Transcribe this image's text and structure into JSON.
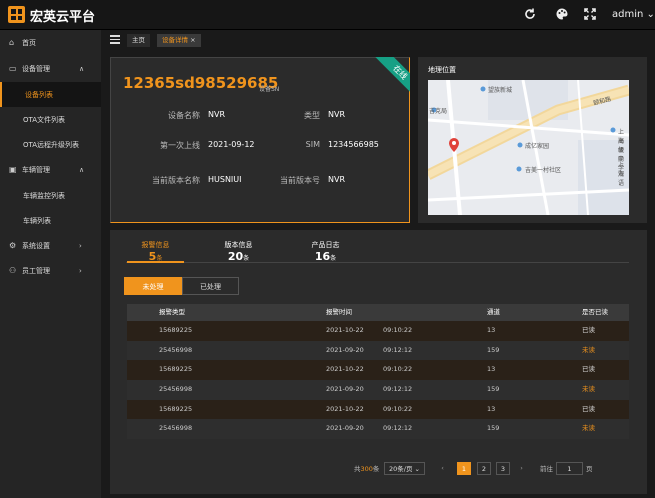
{
  "header": {
    "app_title": "宏英云平台",
    "refresh_icon": "refresh-icon",
    "theme_icon": "palette-icon",
    "fullscreen_icon": "fullscreen-icon",
    "user": "admin"
  },
  "sidebar": {
    "items": [
      {
        "label": "首页",
        "icon": "home-icon"
      },
      {
        "label": "设备管理",
        "icon": "device-icon"
      },
      {
        "label": "设备列表"
      },
      {
        "label": "OTA文件列表"
      },
      {
        "label": "OTA远程升级列表"
      },
      {
        "label": "车辆管理",
        "icon": "car-icon"
      },
      {
        "label": "车辆监控列表"
      },
      {
        "label": "车辆列表"
      },
      {
        "label": "系统设置",
        "icon": "gear-icon"
      },
      {
        "label": "员工管理",
        "icon": "user-icon"
      }
    ]
  },
  "tabs": [
    {
      "label": "主页"
    },
    {
      "label": "设备详情",
      "close": "×"
    }
  ],
  "device": {
    "sn": "12365sd98529685",
    "sn_label": "设备SN",
    "status": "在线",
    "name_label": "设备名称",
    "name": "NVR",
    "type_label": "类型",
    "type": "NVR",
    "first_label": "第一次上线",
    "first": "2021-09-12",
    "sim_label": "SIM",
    "sim": "1234566985",
    "cur_ver_label": "当前版本名称",
    "cur_ver": "HUSNIUI",
    "ver_no_label": "当前版本号",
    "ver_no": "NVR"
  },
  "map": {
    "title": "地理位置",
    "labels": [
      "望族新城",
      "吉克局",
      "颐和路",
      "成亿家园",
      "吉美一村社区",
      "上海便民",
      "高级中学",
      "上海",
      "双语"
    ]
  },
  "stats": {
    "tabs": [
      {
        "label": "报警信息",
        "count": "5",
        "unit": "条"
      },
      {
        "label": "版本信息",
        "count": "20",
        "unit": "条"
      },
      {
        "label": "产品日志",
        "count": "16",
        "unit": "条"
      }
    ]
  },
  "filter": {
    "pending": "未处理",
    "done": "已处理"
  },
  "table": {
    "headers": [
      "报警类型",
      "报警时间",
      "通道",
      "是否已读"
    ],
    "rows": [
      {
        "type": "15689225",
        "date": "2021-10-22",
        "time": "09:10:22",
        "channel": "13",
        "read": "已读"
      },
      {
        "type": "25456998",
        "date": "2021-09-20",
        "time": "09:12:12",
        "channel": "159",
        "read": "未读"
      },
      {
        "type": "15689225",
        "date": "2021-10-22",
        "time": "09:10:22",
        "channel": "13",
        "read": "已读"
      },
      {
        "type": "25456998",
        "date": "2021-09-20",
        "time": "09:12:12",
        "channel": "159",
        "read": "未读"
      },
      {
        "type": "15689225",
        "date": "2021-10-22",
        "time": "09:10:22",
        "channel": "13",
        "read": "已读"
      },
      {
        "type": "25456998",
        "date": "2021-09-20",
        "time": "09:12:12",
        "channel": "159",
        "read": "未读"
      }
    ]
  },
  "pagination": {
    "total_prefix": "共",
    "total": "300",
    "total_suffix": "条",
    "page_size": "20条/页",
    "pages": [
      "1",
      "2",
      "3"
    ],
    "prev": "‹",
    "next": "›",
    "goto_label": "前往",
    "goto_value": "1",
    "goto_suffix": "页"
  },
  "colors": {
    "accent": "#f0941d",
    "online": "#16a085"
  }
}
